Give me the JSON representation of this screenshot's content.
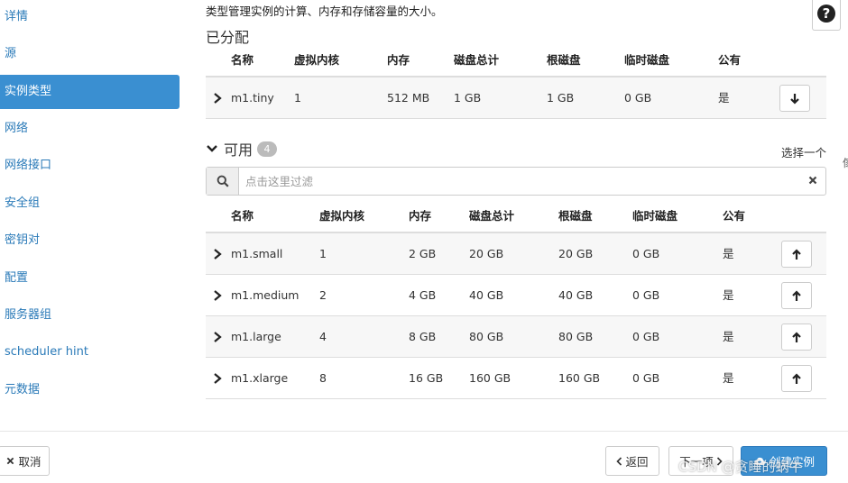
{
  "sidebar": {
    "items": [
      {
        "label": "详情"
      },
      {
        "label": "源"
      },
      {
        "label": "实例类型"
      },
      {
        "label": "网络"
      },
      {
        "label": "网络接口"
      },
      {
        "label": "安全组"
      },
      {
        "label": "密钥对"
      },
      {
        "label": "配置"
      },
      {
        "label": "服务器组"
      },
      {
        "label": "scheduler hint"
      },
      {
        "label": "元数据"
      }
    ]
  },
  "main": {
    "description": "类型管理实例的计算、内存和存储容量的大小。",
    "allocated_title": "已分配",
    "available_title": "可用",
    "available_count": "4",
    "select_one": "选择一个",
    "help_icon": "?",
    "filter": {
      "placeholder": "点击这里过滤"
    },
    "columns": [
      "名称",
      "虚拟内核",
      "内存",
      "磁盘总计",
      "根磁盘",
      "临时磁盘",
      "公有"
    ],
    "allocated": [
      {
        "name": "m1.tiny",
        "vcpus": "1",
        "ram": "512 MB",
        "total_disk": "1 GB",
        "root_disk": "1 GB",
        "ephemeral": "0 GB",
        "public": "是"
      }
    ],
    "available": [
      {
        "name": "m1.small",
        "vcpus": "1",
        "ram": "2 GB",
        "total_disk": "20 GB",
        "root_disk": "20 GB",
        "ephemeral": "0 GB",
        "public": "是"
      },
      {
        "name": "m1.medium",
        "vcpus": "2",
        "ram": "4 GB",
        "total_disk": "40 GB",
        "root_disk": "40 GB",
        "ephemeral": "0 GB",
        "public": "是"
      },
      {
        "name": "m1.large",
        "vcpus": "4",
        "ram": "8 GB",
        "total_disk": "80 GB",
        "root_disk": "80 GB",
        "ephemeral": "0 GB",
        "public": "是"
      },
      {
        "name": "m1.xlarge",
        "vcpus": "8",
        "ram": "16 GB",
        "total_disk": "160 GB",
        "root_disk": "160 GB",
        "ephemeral": "0 GB",
        "public": "是"
      }
    ]
  },
  "footer": {
    "cancel_label": "取消",
    "back_label": "返回",
    "next_label": "下一项",
    "create_label": "创建实例"
  },
  "edge_text": "傢",
  "watermark": "CSDN @贪睡的蜗牛",
  "colors": {
    "accent": "#3a8fd1",
    "link": "#2a7ab8"
  }
}
